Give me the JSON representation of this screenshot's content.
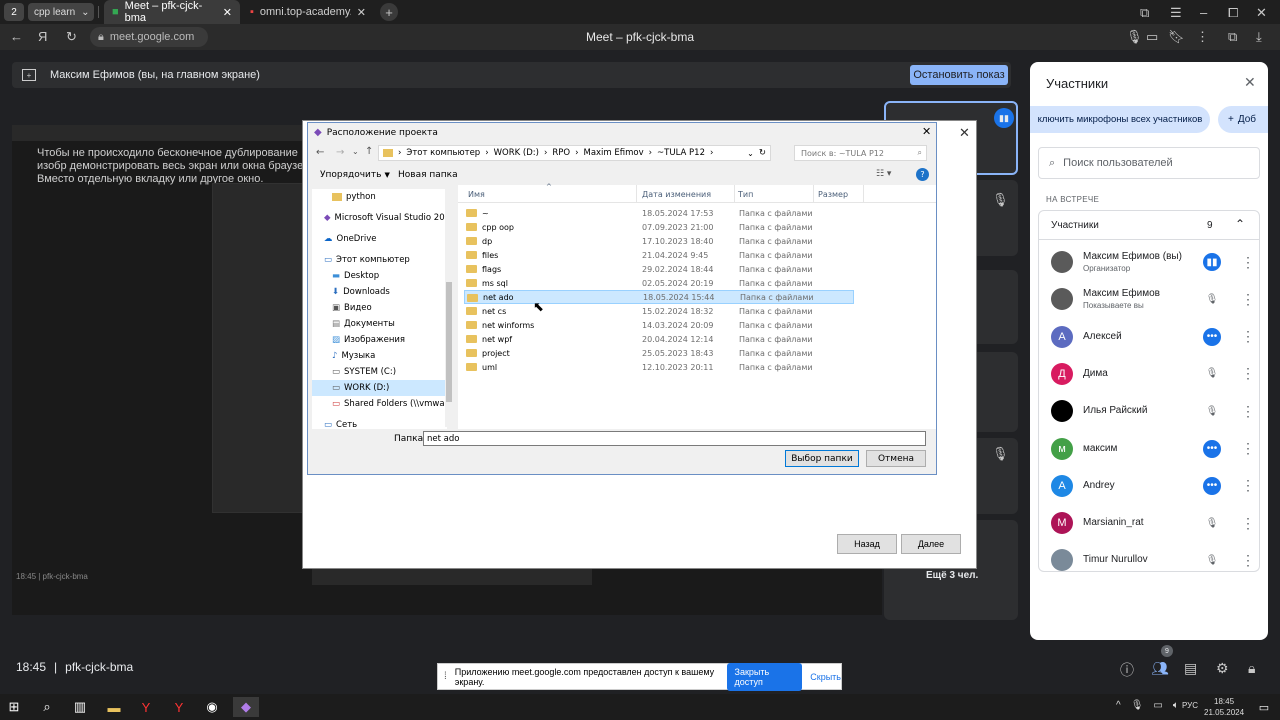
{
  "browser": {
    "tab_group_count": "2",
    "tab_group_label": "cpp learn",
    "tabs": [
      {
        "label": "Meet – pfk-cjck-bma"
      },
      {
        "label": "omni.top-academy.ru/#/p"
      }
    ],
    "address": "meet.google.com",
    "window_title": "Meet – pfk-cjck-bma"
  },
  "meet": {
    "presenting_text": "Максим Ефимов (вы, на главном экране)",
    "stop_label": "Остановить показ",
    "time": "18:45",
    "meeting_code": "pfk-cjck-bma",
    "more_label": "Ещё 3 чел.",
    "shared_text": "Чтобы не происходило бесконечное дублирование изобр демонстрировать весь экран или окна браузера. Вместо отдельную вкладку или другое окно."
  },
  "wizard": {
    "back_label": "Назад",
    "next_label": "Далее"
  },
  "file_dialog": {
    "title": "Расположение проекта",
    "breadcrumb": [
      "Этот компьютер",
      "WORK (D:)",
      "RPO",
      "Maxim Efimov",
      "~TULA P12"
    ],
    "search_placeholder": "Поиск в: ~TULA P12",
    "organize_label": "Упорядочить",
    "new_folder_label": "Новая папка",
    "columns": {
      "name": "Имя",
      "date": "Дата изменения",
      "type": "Тип",
      "size": "Размер"
    },
    "nav_items": [
      {
        "label": "python",
        "icon": "folder-icon"
      },
      {
        "label": "Microsoft Visual Studio 2022",
        "icon": "vs-icon"
      },
      {
        "label": "OneDrive",
        "icon": "cloud-icon"
      },
      {
        "label": "Этот компьютер",
        "icon": "computer-icon"
      },
      {
        "label": "Desktop",
        "icon": "desktop-icon"
      },
      {
        "label": "Downloads",
        "icon": "download-icon"
      },
      {
        "label": "Видео",
        "icon": "video-icon"
      },
      {
        "label": "Документы",
        "icon": "document-icon"
      },
      {
        "label": "Изображения",
        "icon": "image-icon"
      },
      {
        "label": "Музыка",
        "icon": "music-icon"
      },
      {
        "label": "SYSTEM (C:)",
        "icon": "drive-icon"
      },
      {
        "label": "WORK (D:)",
        "icon": "drive-icon"
      },
      {
        "label": "Shared Folders (\\\\vmware-h",
        "icon": "network-drive-icon"
      },
      {
        "label": "Сеть",
        "icon": "network-icon"
      }
    ],
    "files": [
      {
        "name": "~",
        "date": "18.05.2024 17:53",
        "type": "Папка с файлами"
      },
      {
        "name": "cpp oop",
        "date": "07.09.2023 21:00",
        "type": "Папка с файлами"
      },
      {
        "name": "dp",
        "date": "17.10.2023 18:40",
        "type": "Папка с файлами"
      },
      {
        "name": "files",
        "date": "21.04.2024 9:45",
        "type": "Папка с файлами"
      },
      {
        "name": "flags",
        "date": "29.02.2024 18:44",
        "type": "Папка с файлами"
      },
      {
        "name": "ms sql",
        "date": "02.05.2024 20:19",
        "type": "Папка с файлами"
      },
      {
        "name": "net ado",
        "date": "18.05.2024 15:44",
        "type": "Папка с файлами"
      },
      {
        "name": "net cs",
        "date": "15.02.2024 18:32",
        "type": "Папка с файлами"
      },
      {
        "name": "net winforms",
        "date": "14.03.2024 20:09",
        "type": "Папка с файлами"
      },
      {
        "name": "net wpf",
        "date": "20.04.2024 12:14",
        "type": "Папка с файлами"
      },
      {
        "name": "project",
        "date": "25.05.2023 18:43",
        "type": "Папка с файлами"
      },
      {
        "name": "uml",
        "date": "12.10.2023 20:11",
        "type": "Папка с файлами"
      }
    ],
    "folder_label": "Папка:",
    "folder_value": "net ado",
    "select_label": "Выбор папки",
    "cancel_label": "Отмена"
  },
  "panel": {
    "title": "Участники",
    "mute_all_label": "ключить микрофоны всех участников",
    "add_label": "Доб",
    "search_placeholder": "Поиск пользователей",
    "section_label": "НА ВСТРЕЧЕ",
    "group_label": "Участники",
    "group_count": "9",
    "participants": [
      {
        "name": "Максим Ефимов (вы)",
        "sub": "Организатор",
        "initial": "",
        "color": "#5a5a5a",
        "status": "speaking"
      },
      {
        "name": "Максим Ефимов",
        "sub": "Показываете вы",
        "initial": "",
        "color": "#5a5a5a",
        "status": "muted"
      },
      {
        "name": "Алексей",
        "sub": "",
        "initial": "А",
        "color": "#5c6bc0",
        "status": "more"
      },
      {
        "name": "Дима",
        "sub": "",
        "initial": "Д",
        "color": "#d81b60",
        "status": "muted"
      },
      {
        "name": "Илья Райский",
        "sub": "",
        "initial": "",
        "color": "#000000",
        "status": "muted"
      },
      {
        "name": "максим",
        "sub": "",
        "initial": "м",
        "color": "#43a047",
        "status": "more"
      },
      {
        "name": "Andrey",
        "sub": "",
        "initial": "A",
        "color": "#1e88e5",
        "status": "more"
      },
      {
        "name": "Marsianin_rat",
        "sub": "",
        "initial": "M",
        "color": "#ad1457",
        "status": "muted"
      },
      {
        "name": "Timur Nurullov",
        "sub": "",
        "initial": "",
        "color": "#7a8a99",
        "status": "muted"
      }
    ]
  },
  "notification": {
    "text": "Приложению meet.google.com предоставлен доступ к вашему экрану.",
    "share_label": "Закрыть доступ",
    "hide_label": "Скрыть"
  },
  "bottom": {
    "people_badge": "9"
  },
  "taskbar": {
    "lang": "РУС",
    "time": "18:45",
    "date": "21.05.2024"
  }
}
